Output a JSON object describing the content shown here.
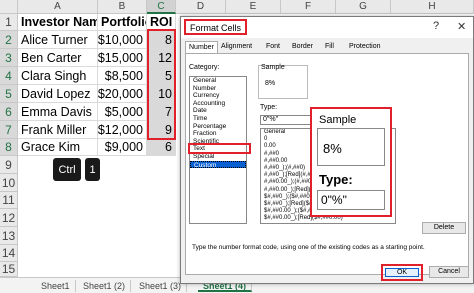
{
  "spreadsheet": {
    "column_headers": [
      "A",
      "B",
      "C",
      "D",
      "E",
      "F",
      "G",
      "H"
    ],
    "row_headers": [
      "1",
      "2",
      "3",
      "4",
      "5",
      "6",
      "7",
      "8",
      "9",
      "10",
      "11",
      "12",
      "13",
      "14",
      "15"
    ],
    "headers": {
      "investor": "Investor Name",
      "portfolio": "Portfolio",
      "roi": "ROI"
    },
    "rows": [
      {
        "name": "Alice Turner",
        "portfolio": "$10,000",
        "roi": "8"
      },
      {
        "name": "Ben Carter",
        "portfolio": "$15,000",
        "roi": "12"
      },
      {
        "name": "Clara Singh",
        "portfolio": "$8,500",
        "roi": "5"
      },
      {
        "name": "David Lopez",
        "portfolio": "$20,000",
        "roi": "10"
      },
      {
        "name": "Emma Davis",
        "portfolio": "$5,000",
        "roi": "7"
      },
      {
        "name": "Frank Miller",
        "portfolio": "$12,000",
        "roi": "9"
      },
      {
        "name": "Grace Kim",
        "portfolio": "$9,000",
        "roi": "6"
      }
    ],
    "shortcut_keys": [
      "Ctrl",
      "1"
    ],
    "sheet_tabs": [
      "Sheet1",
      "Sheet1 (2)",
      "Sheet1 (3)",
      "Sheet1 (4)"
    ],
    "accent_color": "#217346",
    "highlight_color": "#e0202a"
  },
  "dialog": {
    "title": "Format Cells",
    "help_glyph": "?",
    "close_glyph": "✕",
    "tabs": [
      "Number",
      "Alignment",
      "Font",
      "Border",
      "Fill",
      "Protection"
    ],
    "category_label": "Category:",
    "categories": [
      "General",
      "Number",
      "Currency",
      "Accounting",
      "Date",
      "Time",
      "Percentage",
      "Fraction",
      "Scientific",
      "Text",
      "Special",
      "Custom"
    ],
    "selected_category": "Custom",
    "sample_label": "Sample",
    "sample_value": "8%",
    "type_label": "Type:",
    "type_value": "0\"%\"",
    "type_list": [
      "General",
      "0",
      "0.00",
      "#,##0",
      "#,##0.00",
      "#,##0_);(#,##0)",
      "#,##0_);[Red](#,##0)",
      "#,##0.00_);(#,##0.00)",
      "#,##0.00_);[Red](#,##0.00)",
      "$#,##0_);($#,##0)",
      "$#,##0_);[Red]($#,##0)",
      "$#,##0.00_);($#,##0.00)",
      "$#,##0.00_);[Red]($#,##0.00)"
    ],
    "zoom": {
      "sample_label": "Sample",
      "sample_value": "8%",
      "type_label": "Type:",
      "type_value": "0\"%\""
    },
    "delete_button": "Delete",
    "hint": "Type the number format code, using one of the existing codes as a starting point.",
    "ok_button": "OK",
    "cancel_button": "Cancel"
  }
}
